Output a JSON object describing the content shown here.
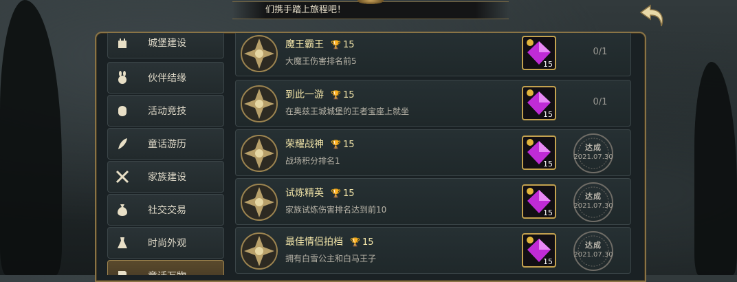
{
  "banner": {
    "text": "们携手踏上旅程吧！"
  },
  "sidebar": {
    "items": [
      {
        "label": "城堡建设",
        "icon": "castle-icon",
        "active": false
      },
      {
        "label": "伙伴结缘",
        "icon": "rabbit-icon",
        "active": false
      },
      {
        "label": "活动竞技",
        "icon": "fist-icon",
        "active": false
      },
      {
        "label": "童话游历",
        "icon": "feather-icon",
        "active": false
      },
      {
        "label": "家族建设",
        "icon": "swords-icon",
        "active": false
      },
      {
        "label": "社交交易",
        "icon": "money-bag-icon",
        "active": false
      },
      {
        "label": "时尚外观",
        "icon": "dress-icon",
        "active": false
      },
      {
        "label": "童话万物",
        "icon": "book-icon",
        "active": true
      }
    ]
  },
  "achievements": [
    {
      "title": "魔王霸王",
      "points": "15",
      "desc": "大魔王伤害排名前5",
      "reward_count": "15",
      "progress": "0/1",
      "done": false
    },
    {
      "title": "到此一游",
      "points": "15",
      "desc": "在奥兹王城城堡的王者宝座上就坐",
      "reward_count": "15",
      "progress": "0/1",
      "done": false
    },
    {
      "title": "荣耀战神",
      "points": "15",
      "desc": "战场积分排名1",
      "reward_count": "15",
      "stamp_label": "达成",
      "stamp_date": "2021.07.30",
      "done": true
    },
    {
      "title": "试炼精英",
      "points": "15",
      "desc": "家族试炼伤害排名达到前10",
      "reward_count": "15",
      "stamp_label": "达成",
      "stamp_date": "2021.07.30",
      "done": true
    },
    {
      "title": "最佳情侣拍档",
      "points": "15",
      "desc": "拥有白雪公主和白马王子",
      "reward_count": "15",
      "stamp_label": "达成",
      "stamp_date": "2021.07.30",
      "done": true
    }
  ],
  "icons": {
    "back": "back-arrow-icon",
    "trophy": "trophy-icon",
    "medal": "medal-icon",
    "reward": "purple-gem-icon"
  },
  "colors": {
    "gold": "#c4a24f",
    "title": "#f1e4a8",
    "gem": "#c02bd6"
  }
}
